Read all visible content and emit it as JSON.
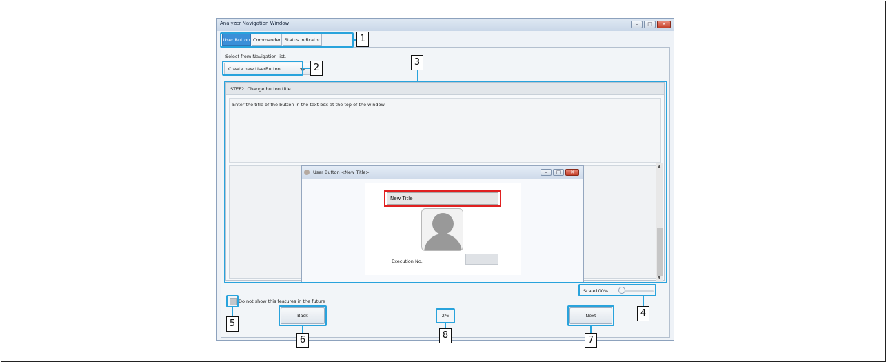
{
  "window": {
    "title": "Analyzer Navigation Window",
    "controls": [
      "–",
      "□",
      "✕"
    ]
  },
  "tabs": [
    {
      "label": "User Button",
      "active": true
    },
    {
      "label": "Commander",
      "active": false
    },
    {
      "label": "Status Indicator",
      "active": false
    }
  ],
  "nav": {
    "select_label": "Select from Navigation list.",
    "dropdown_value": "Create new UserButton"
  },
  "step": {
    "title": "STEP2: Change button title",
    "description": "Enter the title of the button in the text box at the top of the window."
  },
  "preview": {
    "window_title": "User Button <New Title>",
    "title_field_value": "New Title",
    "execution_label": "Execution No."
  },
  "scale": {
    "label": "Scale100%",
    "value_percent": 100
  },
  "checkbox": {
    "label": "Do not show this features in the future",
    "checked": false
  },
  "buttons": {
    "back": "Back",
    "next": "Next"
  },
  "page_indicator": "2/6",
  "callouts": [
    "1",
    "2",
    "3",
    "4",
    "5",
    "6",
    "7",
    "8"
  ],
  "colors": {
    "highlight": "#29a3dc",
    "active_tab": "#3a8fd8",
    "title_field_border": "#e02020"
  }
}
